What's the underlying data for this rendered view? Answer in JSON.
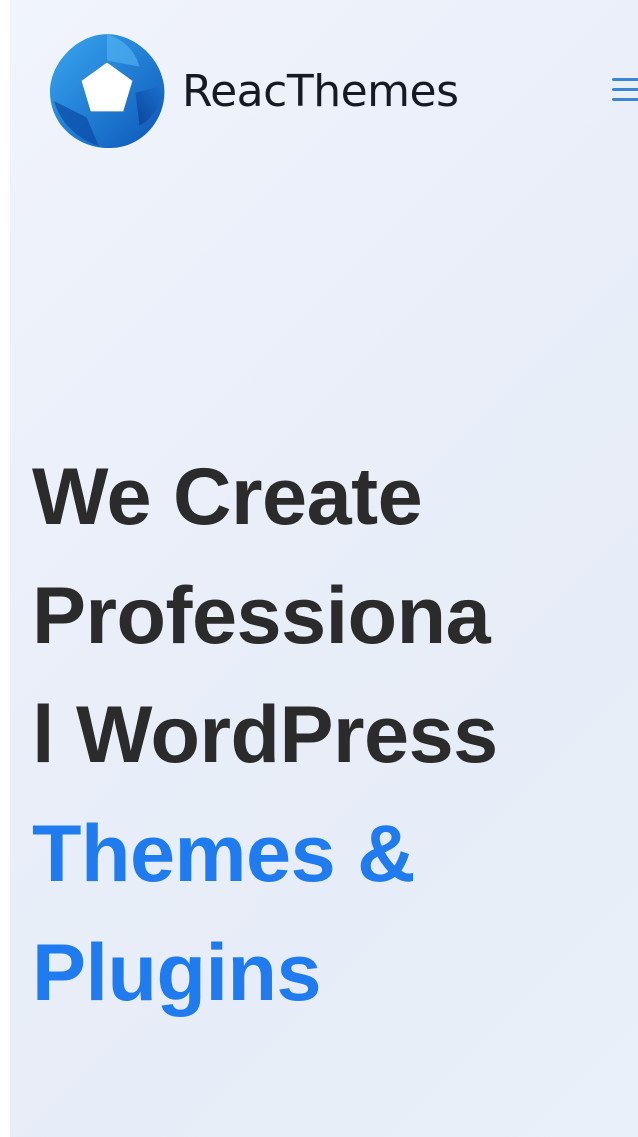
{
  "brand": {
    "name": "ReacThemes"
  },
  "header": {
    "menu_icon": "hamburger-menu-icon"
  },
  "hero": {
    "lines_dark": [
      "We Create",
      "Professiona",
      "l WordPress"
    ],
    "lines_highlight": [
      "Themes &",
      "Plugins"
    ]
  },
  "colors": {
    "text_dark": "#2b2b2b",
    "accent_blue": "#1f7cf0",
    "logo_blue_light": "#1f8fe0",
    "logo_blue_dark": "#0c3f99",
    "menu_icon": "#3a86d6"
  }
}
